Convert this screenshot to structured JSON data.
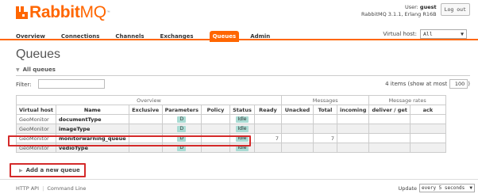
{
  "brand": {
    "name_bold": "Rabbit",
    "name_light": "MQ",
    "tm": "™"
  },
  "user": {
    "line1_prefix": "User: ",
    "username": "guest",
    "line2": "RabbitMQ 3.1.1, Erlang R16B",
    "logout_label": "Log out"
  },
  "nav": {
    "items": [
      "Overview",
      "Connections",
      "Channels",
      "Exchanges",
      "Queues",
      "Admin"
    ],
    "active": "Queues"
  },
  "vhost": {
    "label": "Virtual host:",
    "selected": "All"
  },
  "page": {
    "title": "Queues"
  },
  "section": {
    "title": "All queues"
  },
  "filter": {
    "label": "Filter:",
    "value": ""
  },
  "pagination": {
    "text": "4 items (show at most",
    "max": "100",
    "close": ")"
  },
  "table": {
    "groups": [
      "Overview",
      "Messages",
      "Message rates"
    ],
    "headers": {
      "vhost": "Virtual host",
      "name": "Name",
      "exclusive": "Exclusive",
      "parameters": "Parameters",
      "policy": "Policy",
      "status": "Status",
      "ready": "Ready",
      "unacked": "Unacked",
      "total": "Total",
      "incoming": "incoming",
      "deliver": "deliver / get",
      "ack": "ack"
    },
    "rows": [
      {
        "vhost": "GeoMonitor",
        "name": "documentType",
        "exclusive": "",
        "param": "D",
        "policy": "",
        "status": "Idle",
        "ready": "",
        "unacked": "",
        "total": "",
        "incoming": "",
        "deliver": "",
        "ack": ""
      },
      {
        "vhost": "GeoMonitor",
        "name": "imageType",
        "exclusive": "",
        "param": "D",
        "policy": "",
        "status": "Idle",
        "ready": "",
        "unacked": "",
        "total": "",
        "incoming": "",
        "deliver": "",
        "ack": ""
      },
      {
        "vhost": "GeoMonitor",
        "name": "monitorwarning_queue",
        "exclusive": "",
        "param": "D",
        "policy": "",
        "status": "Idle",
        "ready": "7",
        "unacked": "",
        "total": "7",
        "incoming": "",
        "deliver": "",
        "ack": ""
      },
      {
        "vhost": "GeoMonitor",
        "name": "vedioType",
        "exclusive": "",
        "param": "D",
        "policy": "",
        "status": "Idle",
        "ready": "",
        "unacked": "",
        "total": "",
        "incoming": "",
        "deliver": "",
        "ack": ""
      }
    ]
  },
  "add_queue": {
    "label": "Add a new queue"
  },
  "footer": {
    "http_api": "HTTP API",
    "command_line": "Command Line",
    "separator": "|"
  },
  "update": {
    "label": "Update",
    "selected": "every 5 seconds"
  },
  "colors": {
    "accent": "#ff6600",
    "badge": "#aadcd4",
    "highlight": "#d42a2a"
  },
  "icons": {
    "dropdown": "chevron-down-icon",
    "expand": "triangle-right-icon",
    "collapse": "triangle-down-icon"
  }
}
